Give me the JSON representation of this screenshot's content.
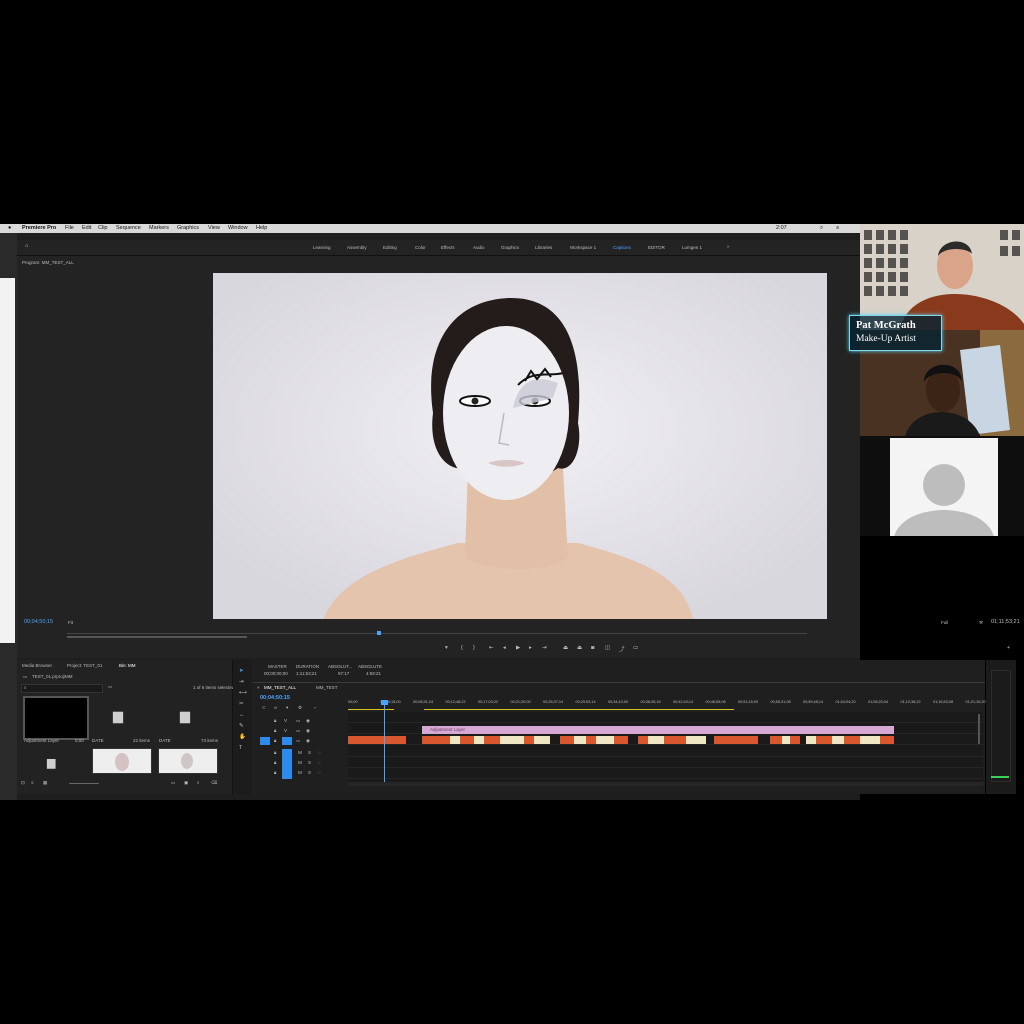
{
  "menubar": {
    "app": "Premiere Pro",
    "items": [
      "File",
      "Edit",
      "Clip",
      "Sequence",
      "Markers",
      "Graphics",
      "View",
      "Window",
      "Help"
    ],
    "clock": "2:07",
    "filepath": "/Users/pat/Desktop/Titles/TEST_ALL.prproj"
  },
  "workspaces": [
    "Learning",
    "Assembly",
    "Editing",
    "Color",
    "Effects",
    "Audio",
    "Graphics",
    "Libraries",
    "Workspace 1",
    "Captions",
    "EDITOR",
    "Lumgen 1"
  ],
  "active_workspace": "Captions",
  "program_panel": {
    "title": "Program: MM_TEST_ALL",
    "timecode_left": "00;04;50;15",
    "fit": "Fit",
    "quality": "Full",
    "timecode_right": "01;11;53;21"
  },
  "project_panel": {
    "tabs": [
      "Media Browser",
      "Project: TEST_01",
      "Bin: MM"
    ],
    "path": "TEST_01.prproj\\MM",
    "search_placeholder": "",
    "selection": "1 of 6 items selected",
    "items": [
      {
        "label": "Adjustment Layer",
        "meta": "0;00"
      },
      {
        "label": "DATE",
        "meta": "22 items"
      },
      {
        "label": "DATE",
        "meta": "73 items"
      }
    ]
  },
  "timeline": {
    "tabs": [
      "MM_TEST_ALL",
      "MM_TEST"
    ],
    "timecode": "00;04;50;15",
    "info_headers": [
      "MASTER",
      "DURATION",
      "ABSOLUT...",
      "ABSOLUTE"
    ],
    "info_values": [
      "00;00;00;00",
      "1;11;53;21",
      "97:17",
      "4:59:21"
    ],
    "ruler": [
      "00;00",
      "00;04;15;00",
      "00;08;31;24",
      "00;12;48;22",
      "00;17;03;22",
      "00;21;20;00",
      "00;25;37;14",
      "00;29;53;14",
      "00;34;10;00",
      "00;38;26;16",
      "00;42;43;14",
      "00;46;59;08",
      "00;51;15;00",
      "00;55;31;08",
      "00;59;48;14",
      "01;04;04;20",
      "01;08;20;04",
      "01;12;36;22",
      "01;16;53;08",
      "01;21;10;20"
    ],
    "adjustment_label": "Adjustment Layer"
  },
  "call": {
    "name": "Pat McGrath",
    "title": "Make-Up Artist"
  },
  "colors": {
    "accent": "#2d8ceb",
    "clip_orange": "#d9572e",
    "clip_pink": "#d6a8d4",
    "clip_cream": "#efe6c4",
    "playhead": "#4aa3ff",
    "lower_third_border": "#7fd8ee"
  }
}
